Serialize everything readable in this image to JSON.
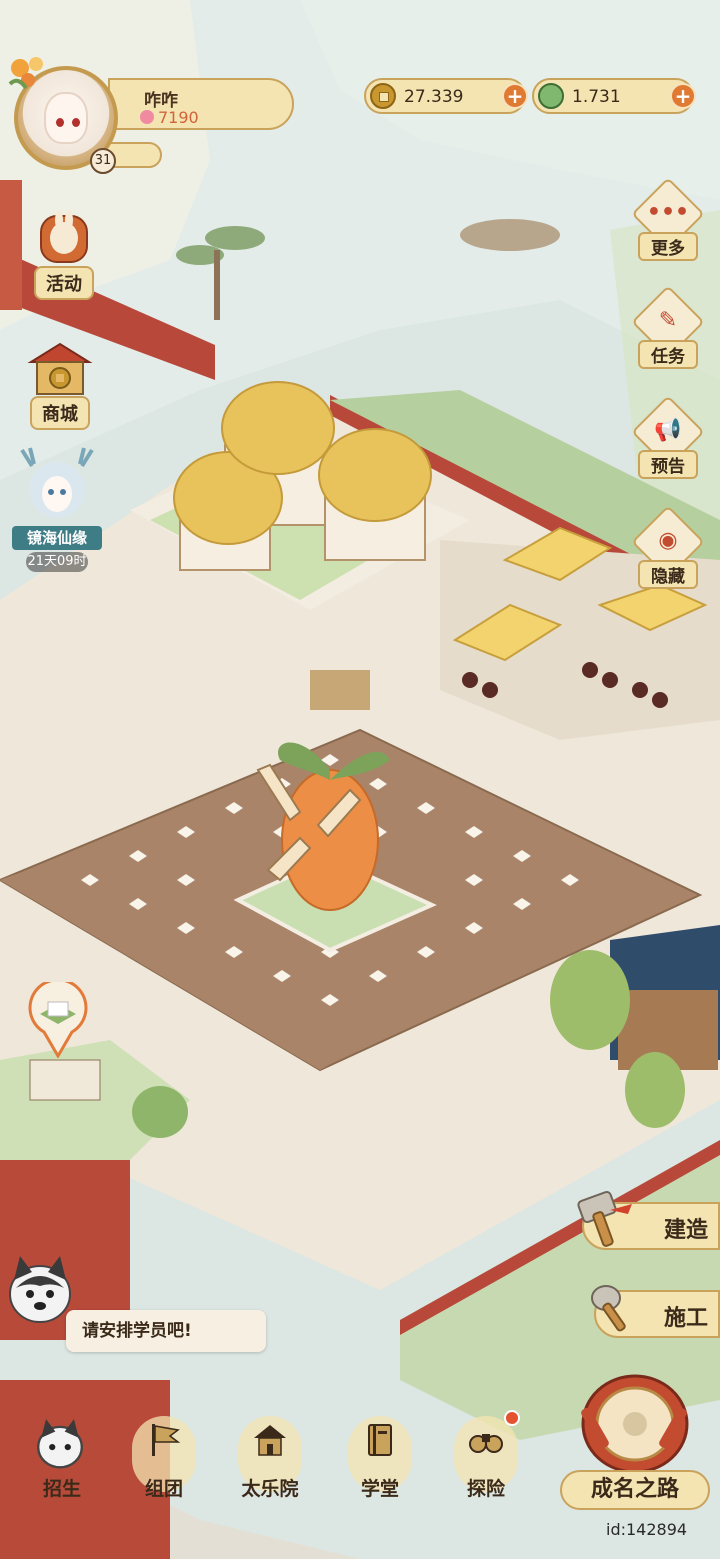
{
  "player": {
    "name": "咋咋",
    "points": "7190",
    "level": "31"
  },
  "resources": {
    "gold": "27.339",
    "jade": "1.731"
  },
  "left_menu": [
    {
      "label": "活动",
      "icon": "activity-icon"
    },
    {
      "label": "商城",
      "icon": "shop-icon"
    }
  ],
  "event": {
    "label": "镜海仙缘",
    "timer": "21天09时"
  },
  "right_menu": [
    {
      "label": "更多",
      "icon": "more-icon"
    },
    {
      "label": "任务",
      "icon": "task-icon"
    },
    {
      "label": "预告",
      "icon": "announce-icon"
    },
    {
      "label": "隐藏",
      "icon": "hide-icon"
    }
  ],
  "actions": {
    "build": "建造",
    "construct": "施工"
  },
  "hint": "请安排学员吧!",
  "bottom_menu": [
    {
      "label": "招生",
      "icon": "recruit-icon"
    },
    {
      "label": "组团",
      "icon": "team-icon"
    },
    {
      "label": "太乐院",
      "icon": "music-hall-icon"
    },
    {
      "label": "学堂",
      "icon": "school-icon"
    },
    {
      "label": "探险",
      "icon": "explore-icon"
    }
  ],
  "fame": "成名之路",
  "user_id": "id:142894",
  "colors": {
    "accent": "#c9a35c",
    "panel": "#f4e4b2",
    "plus": "#e07a32"
  }
}
